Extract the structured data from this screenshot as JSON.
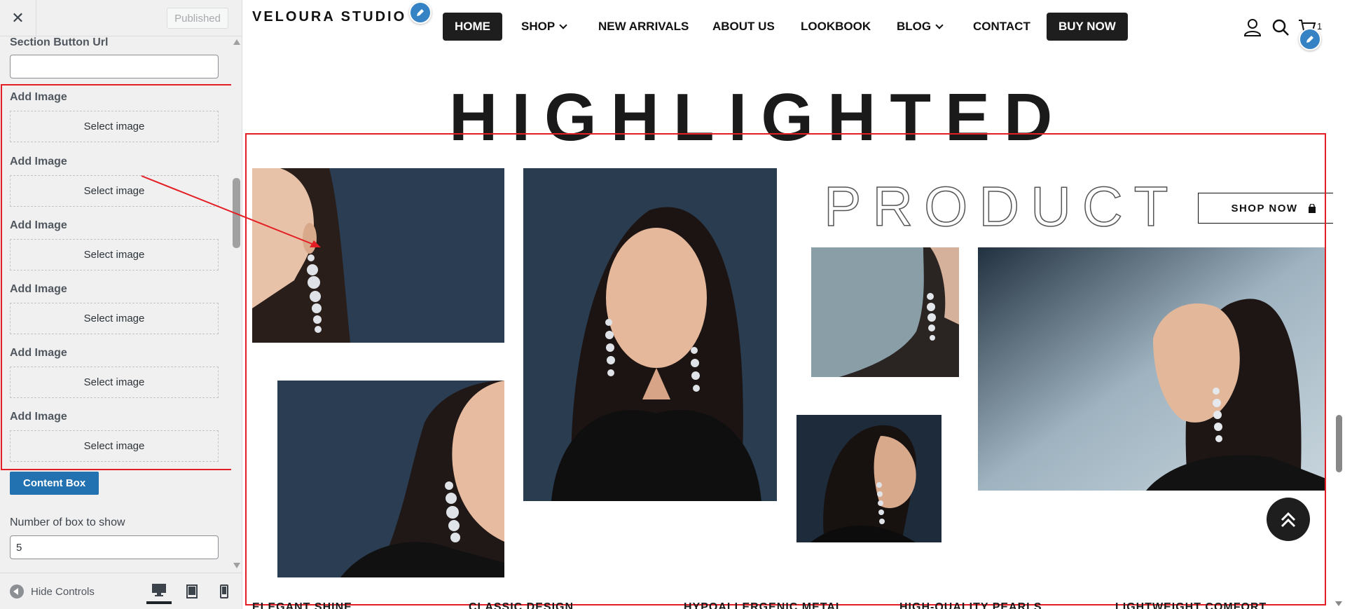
{
  "sidebar": {
    "close_label": "✕",
    "published_label": "Published",
    "section_button_url_label": "Section Button Url",
    "section_button_url_value": "",
    "add_image_label": "Add Image",
    "select_image_label": "Select image",
    "images": [
      {
        "label": "Add Image",
        "button": "Select image"
      },
      {
        "label": "Add Image",
        "button": "Select image"
      },
      {
        "label": "Add Image",
        "button": "Select image"
      },
      {
        "label": "Add Image",
        "button": "Select image"
      },
      {
        "label": "Add Image",
        "button": "Select image"
      },
      {
        "label": "Add Image",
        "button": "Select image"
      }
    ],
    "content_box_button": "Content Box",
    "number_of_box_label": "Number of box to show",
    "number_of_box_value": "5",
    "hide_controls_label": "Hide Controls",
    "devices": [
      "desktop-icon",
      "tablet-icon",
      "mobile-icon"
    ]
  },
  "site": {
    "logo": "VELOURA STUDIO",
    "nav": {
      "home": "HOME",
      "shop": "SHOP",
      "new_arrivals": "NEW ARRIVALS",
      "about": "ABOUT US",
      "lookbook": "LOOKBOOK",
      "blog": "BLOG",
      "contact": "CONTACT",
      "buy_now": "BUY NOW"
    },
    "cart_count": "1",
    "title_solid": "HIGHLIGHTED",
    "title_outline": "PRODUCT",
    "shop_now": "SHOP NOW",
    "features": [
      "ELEGANT SHINE",
      "CLASSIC DESIGN",
      "HYPOALLERGENIC METAL",
      "HIGH-QUALITY PEARLS",
      "LIGHTWEIGHT COMFORT"
    ]
  },
  "colors": {
    "accent_blue": "#2271b1",
    "annotation_red": "#e31e24",
    "dark": "#1e1e1e",
    "photo_navy": "#2a3a4d"
  }
}
